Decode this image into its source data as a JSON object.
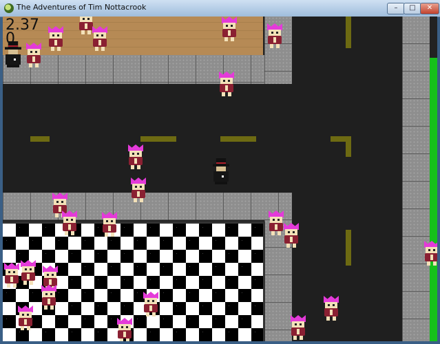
{
  "window": {
    "title": "The Adventures of Tim Nottacrook",
    "min_label": "–",
    "max_label": "□",
    "close_label": "✕",
    "app_icon": "game-app-icon"
  },
  "hud": {
    "timer": "2.37",
    "score": "0"
  },
  "colors": {
    "road": "#1f1f1f",
    "lane_marking": "#6d6a12",
    "sidewalk": "#8e8e8e",
    "grass": "#16c01b",
    "npc_crown": "#e43ad9",
    "npc_body": "#8a2032"
  }
}
